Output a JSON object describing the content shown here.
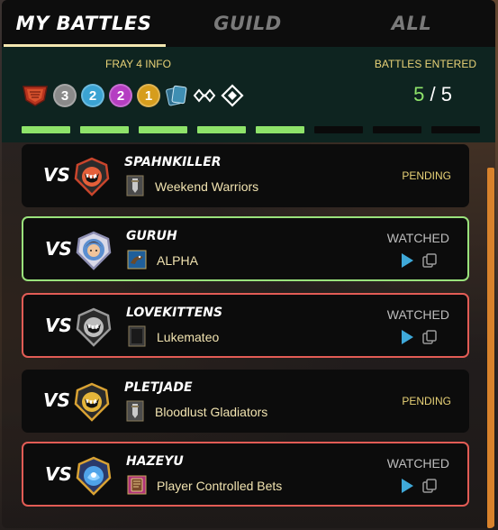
{
  "tabs": [
    {
      "label": "MY BATTLES",
      "active": true
    },
    {
      "label": "GUILD",
      "active": false
    },
    {
      "label": "ALL",
      "active": false
    }
  ],
  "header": {
    "fray_label": "FRAY 4 INFO",
    "battles_entered_label": "BATTLES ENTERED",
    "entered_count": "5",
    "entered_separator": " / ",
    "entered_total": "5",
    "rarity_counts": [
      "3",
      "2",
      "2",
      "1"
    ],
    "progress_filled": 5,
    "progress_total": 8
  },
  "battles": [
    {
      "vs": "VS",
      "name": "SPAHNKILLER",
      "guild": "Weekend Warriors",
      "status": "PENDING"
    },
    {
      "vs": "VS",
      "name": "GURUH",
      "guild": "ALPHA",
      "status": "WATCHED"
    },
    {
      "vs": "VS",
      "name": "LOVEKITTENS",
      "guild": "Lukemateo",
      "status": "WATCHED"
    },
    {
      "vs": "VS",
      "name": "PLETJADE",
      "guild": "Bloodlust Gladiators",
      "status": "PENDING"
    },
    {
      "vs": "VS",
      "name": "HAZEYU",
      "guild": "Player Controlled Bets",
      "status": "WATCHED"
    }
  ],
  "colors": {
    "accent_green": "#8ee36a",
    "accent_gold": "#e8d277",
    "border_win": "#9ae27c",
    "border_loss": "#e25c55"
  }
}
